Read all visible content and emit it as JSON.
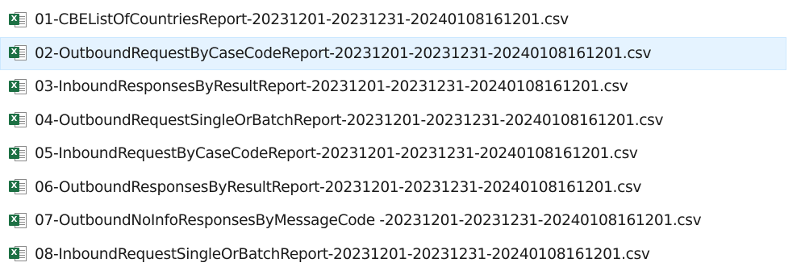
{
  "files": [
    {
      "name": "01-CBEListOfCountriesReport-20231201-20231231-20240108161201.csv",
      "selected": false
    },
    {
      "name": "02-OutboundRequestByCaseCodeReport-20231201-20231231-20240108161201.csv",
      "selected": true
    },
    {
      "name": "03-InboundResponsesByResultReport-20231201-20231231-20240108161201.csv",
      "selected": false
    },
    {
      "name": "04-OutboundRequestSingleOrBatchReport-20231201-20231231-20240108161201.csv",
      "selected": false
    },
    {
      "name": "05-InboundRequestByCaseCodeReport-20231201-20231231-20240108161201.csv",
      "selected": false
    },
    {
      "name": "06-OutboundResponsesByResultReport-20231201-20231231-20240108161201.csv",
      "selected": false
    },
    {
      "name": "07-OutboundNoInfoResponsesByMessageCode -20231201-20231231-20240108161201.csv",
      "selected": false
    },
    {
      "name": "08-InboundRequestSingleOrBatchReport-20231201-20231231-20240108161201.csv",
      "selected": false
    }
  ],
  "icon": {
    "name": "excel-csv-file-icon",
    "badge_letter": "X"
  },
  "colors": {
    "selected_bg": "#e5f3ff",
    "selected_border": "#cce8ff",
    "excel_green": "#1d7044"
  }
}
